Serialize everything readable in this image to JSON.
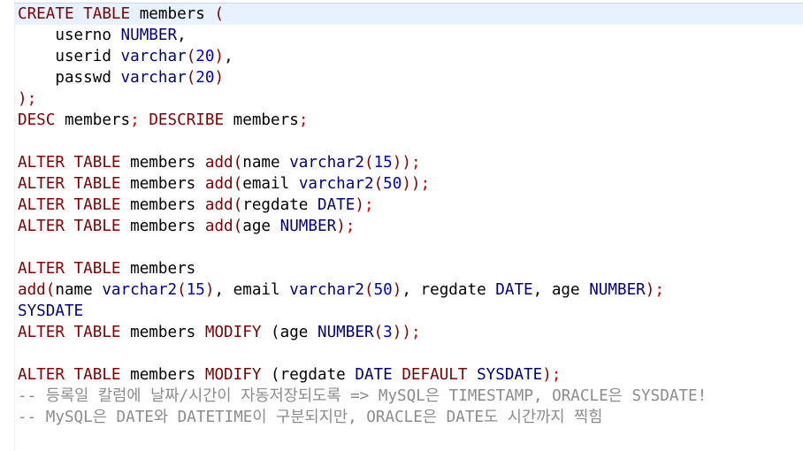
{
  "editor": {
    "colors": {
      "background": "#ffffff",
      "current_line": "#e8f2fe",
      "keyword": "#7f0000",
      "type": "#00007f",
      "number": "#0000d0",
      "semicolon": "#d00000",
      "identifier": "#000000",
      "comment": "#8c8c8c"
    },
    "lines": [
      [
        [
          "kw",
          "CREATE TABLE"
        ],
        [
          "id",
          " members "
        ],
        [
          "punc",
          "("
        ]
      ],
      [
        [
          "id",
          "    userno "
        ],
        [
          "type",
          "NUMBER"
        ],
        [
          "id",
          ","
        ]
      ],
      [
        [
          "id",
          "    userid "
        ],
        [
          "type",
          "varchar"
        ],
        [
          "punc",
          "("
        ],
        [
          "num",
          "20"
        ],
        [
          "punc",
          ")"
        ],
        [
          "id",
          ","
        ]
      ],
      [
        [
          "id",
          "    passwd "
        ],
        [
          "type",
          "varchar"
        ],
        [
          "punc",
          "("
        ],
        [
          "num",
          "20"
        ],
        [
          "punc",
          ")"
        ]
      ],
      [
        [
          "punc",
          ")"
        ],
        [
          "semi",
          ";"
        ]
      ],
      [
        [
          "kw",
          "DESC"
        ],
        [
          "id",
          " members"
        ],
        [
          "semi",
          ";"
        ],
        [
          "id",
          " "
        ],
        [
          "kw",
          "DESCRIBE"
        ],
        [
          "id",
          " members"
        ],
        [
          "semi",
          ";"
        ]
      ],
      [],
      [
        [
          "kw",
          "ALTER TABLE"
        ],
        [
          "id",
          " members "
        ],
        [
          "kw",
          "add"
        ],
        [
          "punc",
          "("
        ],
        [
          "id",
          "name "
        ],
        [
          "type",
          "varchar2"
        ],
        [
          "punc",
          "("
        ],
        [
          "num",
          "15"
        ],
        [
          "punc",
          "))"
        ],
        [
          "semi",
          ";"
        ]
      ],
      [
        [
          "kw",
          "ALTER TABLE"
        ],
        [
          "id",
          " members "
        ],
        [
          "kw",
          "add"
        ],
        [
          "punc",
          "("
        ],
        [
          "id",
          "email "
        ],
        [
          "type",
          "varchar2"
        ],
        [
          "punc",
          "("
        ],
        [
          "num",
          "50"
        ],
        [
          "punc",
          "))"
        ],
        [
          "semi",
          ";"
        ]
      ],
      [
        [
          "kw",
          "ALTER TABLE"
        ],
        [
          "id",
          " members "
        ],
        [
          "kw",
          "add"
        ],
        [
          "punc",
          "("
        ],
        [
          "id",
          "regdate "
        ],
        [
          "type",
          "DATE"
        ],
        [
          "punc",
          ")"
        ],
        [
          "semi",
          ";"
        ]
      ],
      [
        [
          "kw",
          "ALTER TABLE"
        ],
        [
          "id",
          " members "
        ],
        [
          "kw",
          "add"
        ],
        [
          "punc",
          "("
        ],
        [
          "id",
          "age "
        ],
        [
          "type",
          "NUMBER"
        ],
        [
          "punc",
          ")"
        ],
        [
          "semi",
          ";"
        ]
      ],
      [],
      [
        [
          "kw",
          "ALTER TABLE"
        ],
        [
          "id",
          " members"
        ]
      ],
      [
        [
          "kw",
          "add"
        ],
        [
          "punc",
          "("
        ],
        [
          "id",
          "name "
        ],
        [
          "type",
          "varchar2"
        ],
        [
          "punc",
          "("
        ],
        [
          "num",
          "15"
        ],
        [
          "punc",
          ")"
        ],
        [
          "id",
          ", email "
        ],
        [
          "type",
          "varchar2"
        ],
        [
          "punc",
          "("
        ],
        [
          "num",
          "50"
        ],
        [
          "punc",
          ")"
        ],
        [
          "id",
          ", regdate "
        ],
        [
          "type",
          "DATE"
        ],
        [
          "id",
          ", age "
        ],
        [
          "type",
          "NUMBER"
        ],
        [
          "punc",
          ")"
        ],
        [
          "semi",
          ";"
        ]
      ],
      [
        [
          "type",
          "SYSDATE"
        ]
      ],
      [
        [
          "kw",
          "ALTER TABLE"
        ],
        [
          "id",
          " members "
        ],
        [
          "kw",
          "MODIFY"
        ],
        [
          "id",
          " ("
        ],
        [
          "id",
          "age "
        ],
        [
          "type",
          "NUMBER"
        ],
        [
          "punc",
          "("
        ],
        [
          "num",
          "3"
        ],
        [
          "punc",
          "))"
        ],
        [
          "semi",
          ";"
        ]
      ],
      [],
      [
        [
          "kw",
          "ALTER TABLE"
        ],
        [
          "id",
          " members "
        ],
        [
          "kw",
          "MODIFY"
        ],
        [
          "id",
          " ("
        ],
        [
          "id",
          "regdate "
        ],
        [
          "type",
          "DATE"
        ],
        [
          "id",
          " "
        ],
        [
          "kw",
          "DEFAULT"
        ],
        [
          "id",
          " "
        ],
        [
          "type",
          "SYSDATE"
        ],
        [
          "punc",
          ")"
        ],
        [
          "semi",
          ";"
        ]
      ],
      [
        [
          "comment",
          "-- 등록일 칼럼에 날짜/시간이 자동저장되도록 => MySQL은 TIMESTAMP, ORACLE은 SYSDATE!"
        ]
      ],
      [
        [
          "comment",
          "-- MySQL은 DATE와 DATETIME이 구분되지만, ORACLE은 DATE도 시간까지 찍힘"
        ]
      ]
    ]
  }
}
